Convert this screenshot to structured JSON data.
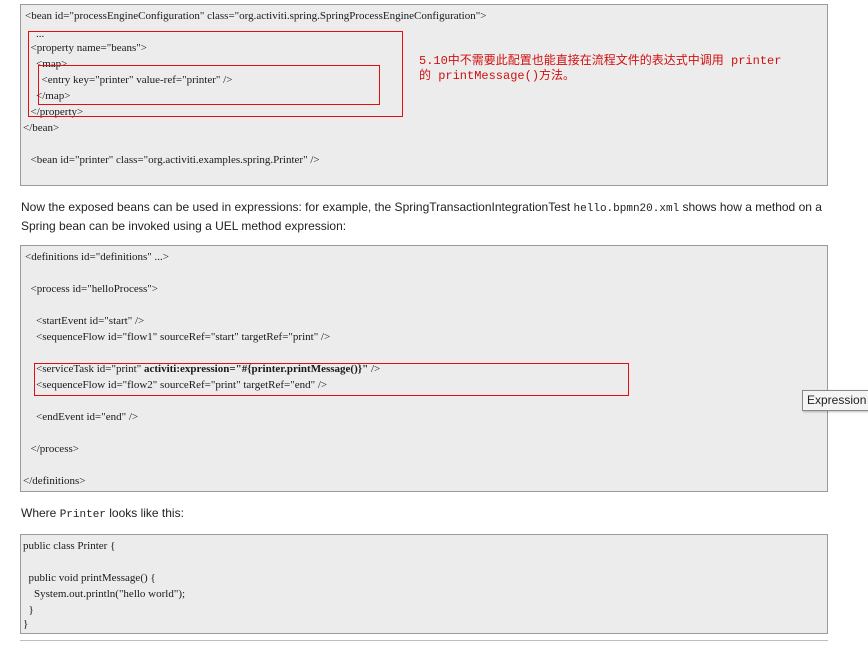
{
  "block1": {
    "lines": [
      "<bean id=\"processEngineConfiguration\" class=\"org.activiti.spring.SpringProcessEngineConfiguration\">",
      "    ...",
      "  <property name=\"beans\">",
      "    <map>",
      "      <entry key=\"printer\" value-ref=\"printer\" />",
      "    </map>",
      "  </property>",
      "</bean>",
      "  <bean id=\"printer\" class=\"org.activiti.examples.spring.Printer\" />"
    ],
    "annotation_line1": "5.10中不需要此配置也能直接在流程文件的表达式中调用 printer",
    "annotation_line2": "的 printMessage()方法。"
  },
  "para1": {
    "text_before": "Now the exposed beans can be used in expressions: for example, the SpringTransactionIntegrationTest ",
    "code": "hello.bpmn20.xml",
    "text_after": " shows how a method on a Spring bean can be invoked using a UEL method expression:"
  },
  "block2": {
    "lines": [
      "<definitions id=\"definitions\" ...>",
      "  <process id=\"helloProcess\">",
      "    <startEvent id=\"start\" />",
      "    <sequenceFlow id=\"flow1\" sourceRef=\"start\" targetRef=\"print\" />",
      "    <serviceTask id=\"print\" ",
      "    <sequenceFlow id=\"flow2\" sourceRef=\"print\" targetRef=\"end\" />",
      "    <endEvent id=\"end\" />",
      "  </process>",
      "</definitions>"
    ],
    "service_expr": "activiti:expression=\"#{printer.printMessage()}\"",
    "service_end": " />"
  },
  "para2": {
    "text_before": "Where ",
    "code": "Printer",
    "text_after": " looks like this:"
  },
  "block3": {
    "lines": [
      "public class Printer {",
      "  public void printMessage() {",
      "    System.out.println(\"hello world\");",
      "  }",
      "}"
    ]
  },
  "tooltip": {
    "text": "Expression"
  }
}
